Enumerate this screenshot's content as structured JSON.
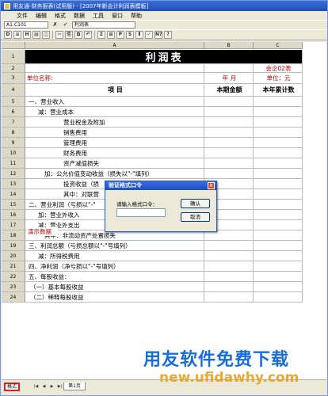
{
  "window": {
    "title": "用友通-财务报表(试用版) - [2007年新会计利润表模板]"
  },
  "menu": {
    "items": [
      "文件",
      "编辑",
      "格式",
      "数据",
      "工具",
      "窗口",
      "帮助"
    ]
  },
  "formula_bar": {
    "cell_ref": "A1:C101",
    "fx_cancel": "✗",
    "fx_accept": "✓",
    "value": "利润表"
  },
  "toolbar": {
    "buttons": [
      "D",
      "≡",
      "H",
      "▤",
      "◫",
      "✂",
      "⎘",
      "⧉",
      "↶",
      "Σ",
      "⊞",
      "P",
      "S",
      "⦀",
      "✓",
      "N?",
      "?"
    ]
  },
  "sheet": {
    "columns": [
      "A",
      "B",
      "C"
    ],
    "rows": [
      {
        "num": "1",
        "a": "利润表",
        "b": "",
        "c": ""
      },
      {
        "num": "2",
        "a": "",
        "b": "",
        "c": "会企02表"
      },
      {
        "num": "3",
        "a": "单位名称:",
        "b": "年   月",
        "c": "单位：元"
      },
      {
        "num": "4",
        "a": "项         目",
        "b": "本期金额",
        "c": "本年累计数"
      },
      {
        "num": "5",
        "a": "一、营业收入",
        "b": "",
        "c": ""
      },
      {
        "num": "6",
        "a": "减：营业成本",
        "b": "",
        "c": ""
      },
      {
        "num": "7",
        "a": "营业税金及附加",
        "b": "",
        "c": ""
      },
      {
        "num": "8",
        "a": "销售费用",
        "b": "",
        "c": ""
      },
      {
        "num": "9",
        "a": "管理费用",
        "b": "",
        "c": ""
      },
      {
        "num": "10",
        "a": "财务费用",
        "b": "",
        "c": ""
      },
      {
        "num": "11",
        "a": "资产减值损失",
        "b": "",
        "c": ""
      },
      {
        "num": "12",
        "a": "加：公允价值变动收益（损失以\"-\"填列）",
        "b": "",
        "c": ""
      },
      {
        "num": "13",
        "a": "投资收益（损",
        "b": "",
        "c": ""
      },
      {
        "num": "14",
        "a": "其中：对联营",
        "b": "",
        "c": ""
      },
      {
        "num": "15",
        "a": "二、营业利润（亏损以\"-\"",
        "b": "",
        "c": ""
      },
      {
        "num": "16",
        "a": "加：营业外收入",
        "b": "",
        "c": ""
      },
      {
        "num": "17",
        "a": "减：营业外支出",
        "b": "",
        "c": ""
      },
      {
        "num": "18",
        "a": "其中：非流动资产处置损失",
        "b": "",
        "c": ""
      },
      {
        "num": "19",
        "a": "三、利润总额（亏损总额以\"-\"号填列）",
        "b": "",
        "c": ""
      },
      {
        "num": "20",
        "a": "减：所得税费用",
        "b": "",
        "c": ""
      },
      {
        "num": "21",
        "a": "四、净利润（净亏损以\"-\"号填列）",
        "b": "",
        "c": ""
      },
      {
        "num": "22",
        "a": "五、每股收益：",
        "b": "",
        "c": ""
      },
      {
        "num": "23",
        "a": "（一）基本每股收益",
        "b": "",
        "c": ""
      },
      {
        "num": "24",
        "a": "（二）稀释每股收益",
        "b": "",
        "c": ""
      }
    ],
    "overlay_note": "演示数据"
  },
  "dialog": {
    "title": "验证格式口令",
    "close": "×",
    "label": "请输入格式口令：",
    "input_value": "",
    "ok_label": "确认",
    "cancel_label": "取消"
  },
  "statusbar": {
    "mode": "格式",
    "nav": [
      "|◀",
      "◀",
      "▶",
      "▶|"
    ],
    "sheet_tab": "第1页"
  },
  "watermark": {
    "line1": "用友软件免费下载",
    "line2": "new.ufidawhy.com"
  },
  "colors": {
    "title_bar": "#1e4fb8",
    "title_cell_bg": "#000000",
    "red_text": "#c00000",
    "watermark_blue": "#1a6cd6",
    "watermark_orange": "#e8a11c"
  }
}
